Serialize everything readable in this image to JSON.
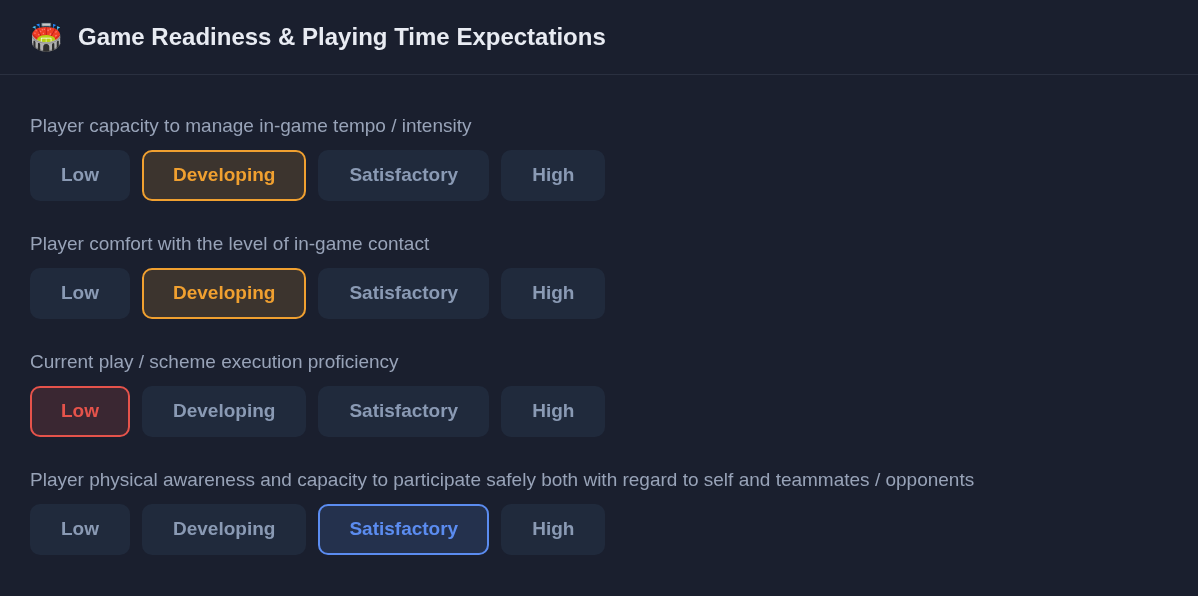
{
  "header": {
    "icon": "🏟️",
    "title": "Game Readiness & Playing Time Expectations"
  },
  "questions": [
    {
      "label": "Player capacity to manage in-game tempo / intensity",
      "options": [
        {
          "label": "Low",
          "selected": false
        },
        {
          "label": "Developing",
          "selected": true,
          "color": "#f0a030"
        },
        {
          "label": "Satisfactory",
          "selected": false
        },
        {
          "label": "High",
          "selected": false
        }
      ]
    },
    {
      "label": "Player comfort with the level of in-game contact",
      "options": [
        {
          "label": "Low",
          "selected": false
        },
        {
          "label": "Developing",
          "selected": true,
          "color": "#f0a030"
        },
        {
          "label": "Satisfactory",
          "selected": false
        },
        {
          "label": "High",
          "selected": false
        }
      ]
    },
    {
      "label": "Current play / scheme execution proficiency",
      "options": [
        {
          "label": "Low",
          "selected": true,
          "color": "#e5534b"
        },
        {
          "label": "Developing",
          "selected": false
        },
        {
          "label": "Satisfactory",
          "selected": false
        },
        {
          "label": "High",
          "selected": false
        }
      ]
    },
    {
      "label": "Player physical awareness and capacity to participate safely both with regard to self and teammates / opponents",
      "options": [
        {
          "label": "Low",
          "selected": false
        },
        {
          "label": "Developing",
          "selected": false
        },
        {
          "label": "Satisfactory",
          "selected": true,
          "color": "#5b8cf0"
        },
        {
          "label": "High",
          "selected": false
        }
      ]
    }
  ]
}
